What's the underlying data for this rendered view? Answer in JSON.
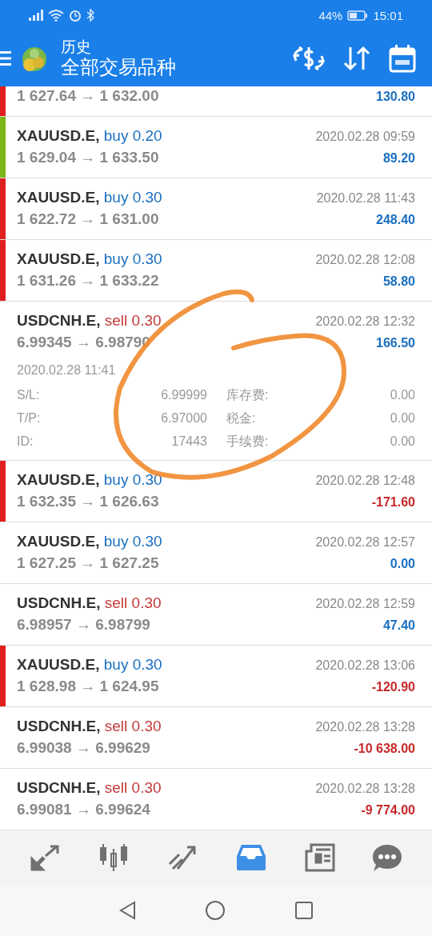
{
  "status_bar": {
    "battery": "44%",
    "time": "15:01"
  },
  "header": {
    "title": "历史",
    "subtitle": "全部交易品种"
  },
  "trades": [
    {
      "price": "1 627.64 → 1 632.00",
      "profit": "130.80",
      "loss": false,
      "color": "#e02020"
    },
    {
      "symbol": "XAUUSD.E,",
      "order": "buy 0.20",
      "kind": "buy",
      "date": "2020.02.28 09:59",
      "price": "1 629.04 → 1 633.50",
      "profit": "89.20",
      "loss": false,
      "color": "#7cb518"
    },
    {
      "symbol": "XAUUSD.E,",
      "order": "buy 0.30",
      "kind": "buy",
      "date": "2020.02.28 11:43",
      "price": "1 622.72 → 1 631.00",
      "profit": "248.40",
      "loss": false,
      "color": "#e02020"
    },
    {
      "symbol": "XAUUSD.E,",
      "order": "buy 0.30",
      "kind": "buy",
      "date": "2020.02.28 12:08",
      "price": "1 631.26 → 1 633.22",
      "profit": "58.80",
      "loss": false,
      "color": "#e02020"
    },
    {
      "symbol": "USDCNH.E,",
      "order": "sell 0.30",
      "kind": "sell",
      "date": "2020.02.28 12:32",
      "price": "6.99345 → 6.98790",
      "profit": "166.50",
      "loss": false,
      "details": {
        "open_time": "2020.02.28 11:41",
        "fields": [
          {
            "label": "S/L:",
            "value": "6.99999",
            "label2": "库存费:",
            "value2": "0.00"
          },
          {
            "label": "T/P:",
            "value": "6.97000",
            "label2": "税金:",
            "value2": "0.00"
          },
          {
            "label": "ID:",
            "value": "17443",
            "label2": "手续费:",
            "value2": "0.00"
          }
        ]
      }
    },
    {
      "symbol": "XAUUSD.E,",
      "order": "buy 0.30",
      "kind": "buy",
      "date": "2020.02.28 12:48",
      "price": "1 632.35 → 1 626.63",
      "profit": "-171.60",
      "loss": true,
      "color": "#e02020"
    },
    {
      "symbol": "XAUUSD.E,",
      "order": "buy 0.30",
      "kind": "buy",
      "date": "2020.02.28 12:57",
      "price": "1 627.25 → 1 627.25",
      "profit": "0.00",
      "loss": false
    },
    {
      "symbol": "USDCNH.E,",
      "order": "sell 0.30",
      "kind": "sell",
      "date": "2020.02.28 12:59",
      "price": "6.98957 → 6.98799",
      "profit": "47.40",
      "loss": false
    },
    {
      "symbol": "XAUUSD.E,",
      "order": "buy 0.30",
      "kind": "buy",
      "date": "2020.02.28 13:06",
      "price": "1 628.98 → 1 624.95",
      "profit": "-120.90",
      "loss": true,
      "color": "#e02020"
    },
    {
      "symbol": "USDCNH.E,",
      "order": "sell 0.30",
      "kind": "sell",
      "date": "2020.02.28 13:28",
      "price": "6.99038 → 6.99629",
      "profit": "-10 638.00",
      "loss": true
    },
    {
      "symbol": "USDCNH.E,",
      "order": "sell 0.30",
      "kind": "sell",
      "date": "2020.02.28 13:28",
      "price": "6.99081 → 6.99624",
      "profit": "-9 774.00",
      "loss": true
    }
  ],
  "bottom_nav": [
    {
      "kind": "quotes",
      "selected": false
    },
    {
      "kind": "chart",
      "selected": false
    },
    {
      "kind": "trade",
      "selected": false
    },
    {
      "kind": "history",
      "selected": true
    },
    {
      "kind": "news",
      "selected": false
    },
    {
      "kind": "chat",
      "selected": false
    }
  ]
}
